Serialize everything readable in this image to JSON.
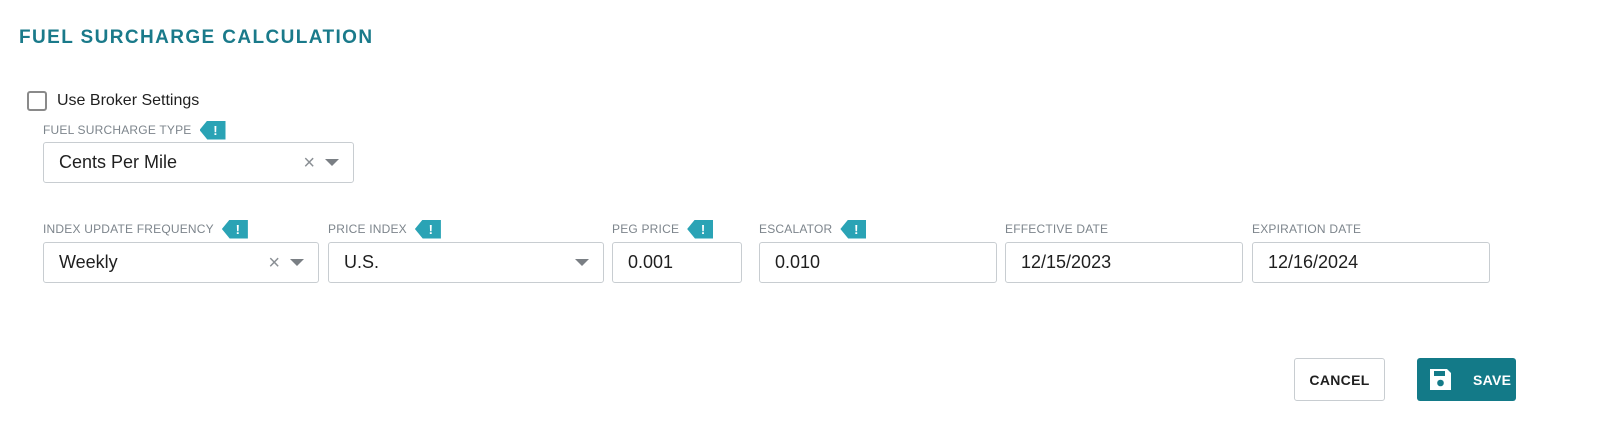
{
  "section": {
    "title": "FUEL SURCHARGE CALCULATION"
  },
  "broker": {
    "label": "Use Broker Settings",
    "checked": false
  },
  "fuel_surcharge_type": {
    "label": "FUEL SURCHARGE TYPE",
    "value": "Cents Per Mile",
    "clear_glyph": "×"
  },
  "index_update_frequency": {
    "label": "INDEX UPDATE FREQUENCY",
    "value": "Weekly",
    "clear_glyph": "×"
  },
  "price_index": {
    "label": "PRICE INDEX",
    "value": "U.S."
  },
  "peg_price": {
    "label": "PEG PRICE",
    "value": "0.001"
  },
  "escalator": {
    "label": "ESCALATOR",
    "value": "0.010"
  },
  "effective_date": {
    "label": "EFFECTIVE DATE",
    "value": "12/15/2023"
  },
  "expiration_date": {
    "label": "EXPIRATION DATE",
    "value": "12/16/2024"
  },
  "info_flag_glyph": "!",
  "actions": {
    "cancel_label": "CANCEL",
    "save_label": "SAVE"
  },
  "colors": {
    "accent": "#1a7a8a",
    "flag": "#2aa3b5",
    "save_button": "#137a88",
    "label_gray": "#7d858c",
    "border": "#c8cdd1"
  },
  "icons": {
    "info": "exclamation-flag-icon",
    "clear": "clear-x-icon",
    "dropdown": "caret-down-icon",
    "save": "floppy-disk-icon"
  }
}
